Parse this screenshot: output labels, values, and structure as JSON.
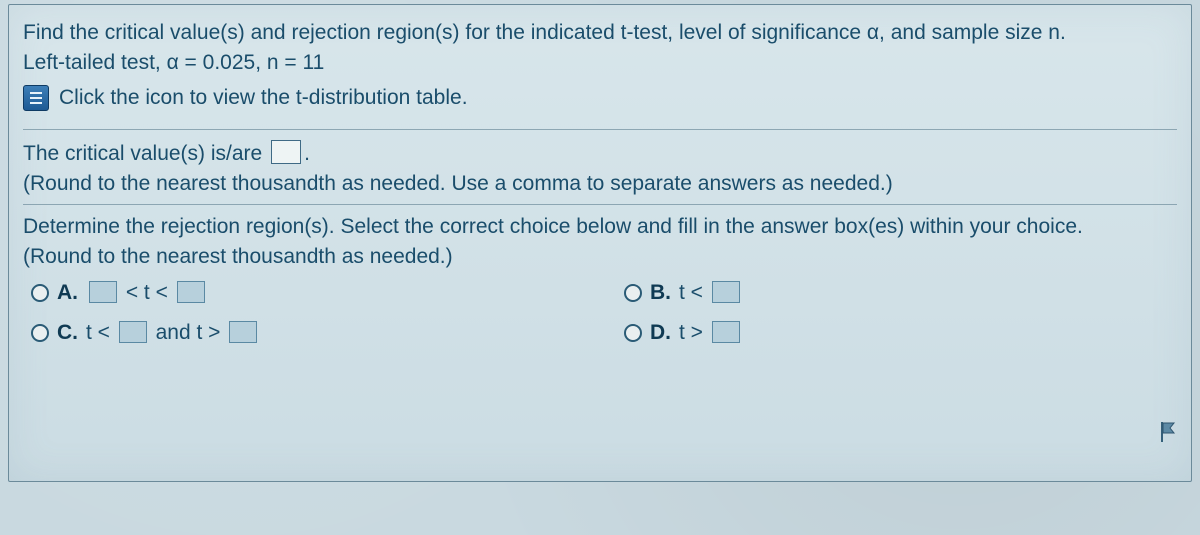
{
  "question": {
    "line1": "Find the critical value(s) and rejection region(s) for the indicated t-test, level of significance α, and sample size n.",
    "line2": "Left-tailed test, α = 0.025, n = 11",
    "icon_link": "Click the icon to view the t-distribution table."
  },
  "part1": {
    "prefix": "The critical value(s) is/are ",
    "suffix": ".",
    "hint": "(Round to the nearest thousandth as needed. Use a comma to separate answers as needed.)"
  },
  "part2": {
    "prompt": "Determine the rejection region(s). Select the correct choice below and fill in the answer box(es) within your choice.",
    "hint": "(Round to the nearest thousandth as needed.)"
  },
  "choices": {
    "A": {
      "label": "A.",
      "mid": " < t < "
    },
    "B": {
      "label": "B.",
      "expr": "t < "
    },
    "C": {
      "label": "C.",
      "expr1": "t < ",
      "mid": " and t > "
    },
    "D": {
      "label": "D.",
      "expr": "t > "
    }
  }
}
